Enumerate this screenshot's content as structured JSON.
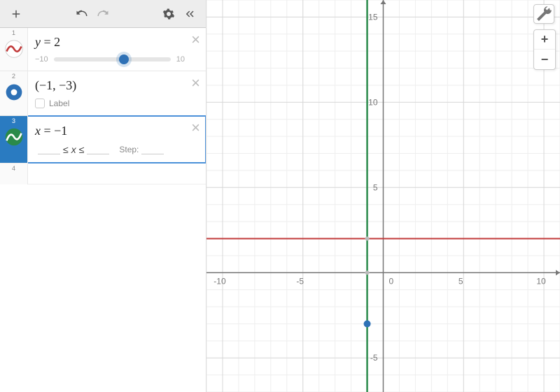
{
  "toolbar": {
    "add": "+",
    "undo": "↶",
    "redo": "↷",
    "settings": "⚙",
    "collapse": "«"
  },
  "expressions": [
    {
      "index": "1",
      "type": "function",
      "iconColor": "#c13a3a",
      "formula_lhs": "y",
      "formula_rhs": "2",
      "slider": {
        "min": "−10",
        "max": "10",
        "position": 60
      }
    },
    {
      "index": "2",
      "type": "point",
      "iconColor": "#2e71b6",
      "formula_full": "(−1, −3)",
      "labelText": "Label",
      "labelChecked": false
    },
    {
      "index": "3",
      "type": "function",
      "iconColor": "#2a8a4a",
      "formula_lhs": "x",
      "formula_rhs": "−1",
      "bounds": {
        "le1": "≤",
        "var": "x",
        "le2": "≤",
        "step": "Step:"
      },
      "selected": true
    },
    {
      "index": "4",
      "type": "empty"
    }
  ],
  "graph_controls": {
    "wrench": "🔧",
    "zoom_in": "+",
    "zoom_out": "−"
  },
  "chart_data": {
    "type": "line",
    "title": "",
    "xlim": [
      -11,
      11
    ],
    "ylim": [
      -7,
      16
    ],
    "grid": true,
    "x_ticks": [
      -10,
      -5,
      0,
      5,
      10
    ],
    "y_ticks": [
      -5,
      5,
      10,
      15
    ],
    "series": [
      {
        "name": "y = 2",
        "type": "hline",
        "value": 2,
        "color": "#c13a3a"
      },
      {
        "name": "x = -1",
        "type": "vline",
        "value": -1,
        "color": "#2a8a4a"
      }
    ],
    "points": [
      {
        "x": -1,
        "y": -3,
        "color": "#2e71b6",
        "label": "(-1, -3)"
      }
    ]
  }
}
